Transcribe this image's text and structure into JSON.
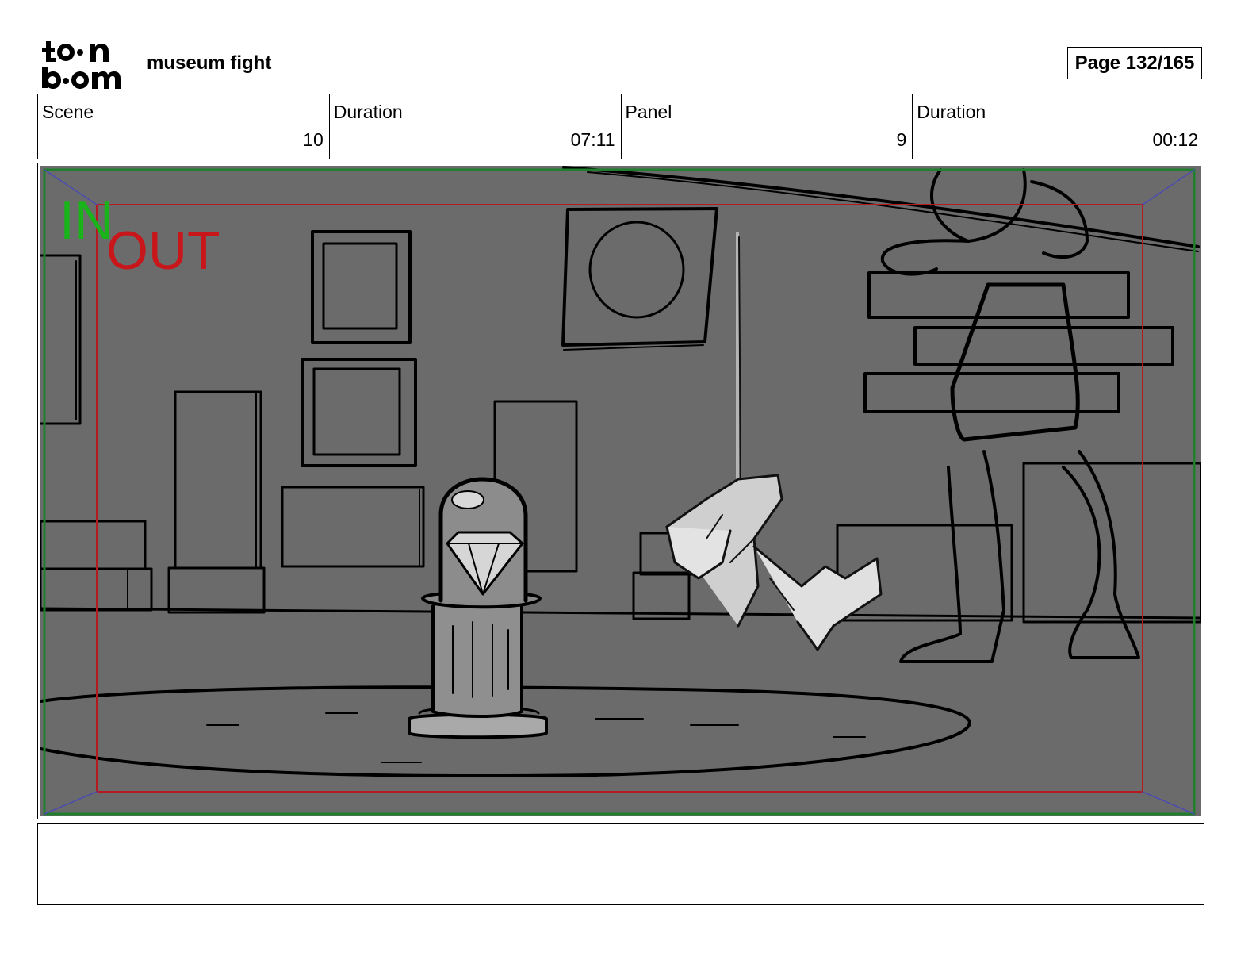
{
  "header": {
    "logo_text": "toon boom",
    "project_title": "museum fight",
    "page_label": "Page 132/165"
  },
  "info": [
    {
      "label": "Scene",
      "value": "10"
    },
    {
      "label": "Duration",
      "value": "07:11"
    },
    {
      "label": "Panel",
      "value": "9"
    },
    {
      "label": "Duration",
      "value": "00:12"
    }
  ],
  "panel": {
    "in_marker": "IN",
    "out_marker": "OUT",
    "in_color": "#19b31a",
    "out_color": "#c8161b",
    "background_color": "#6b6b6b"
  },
  "notes": {
    "text": ""
  }
}
